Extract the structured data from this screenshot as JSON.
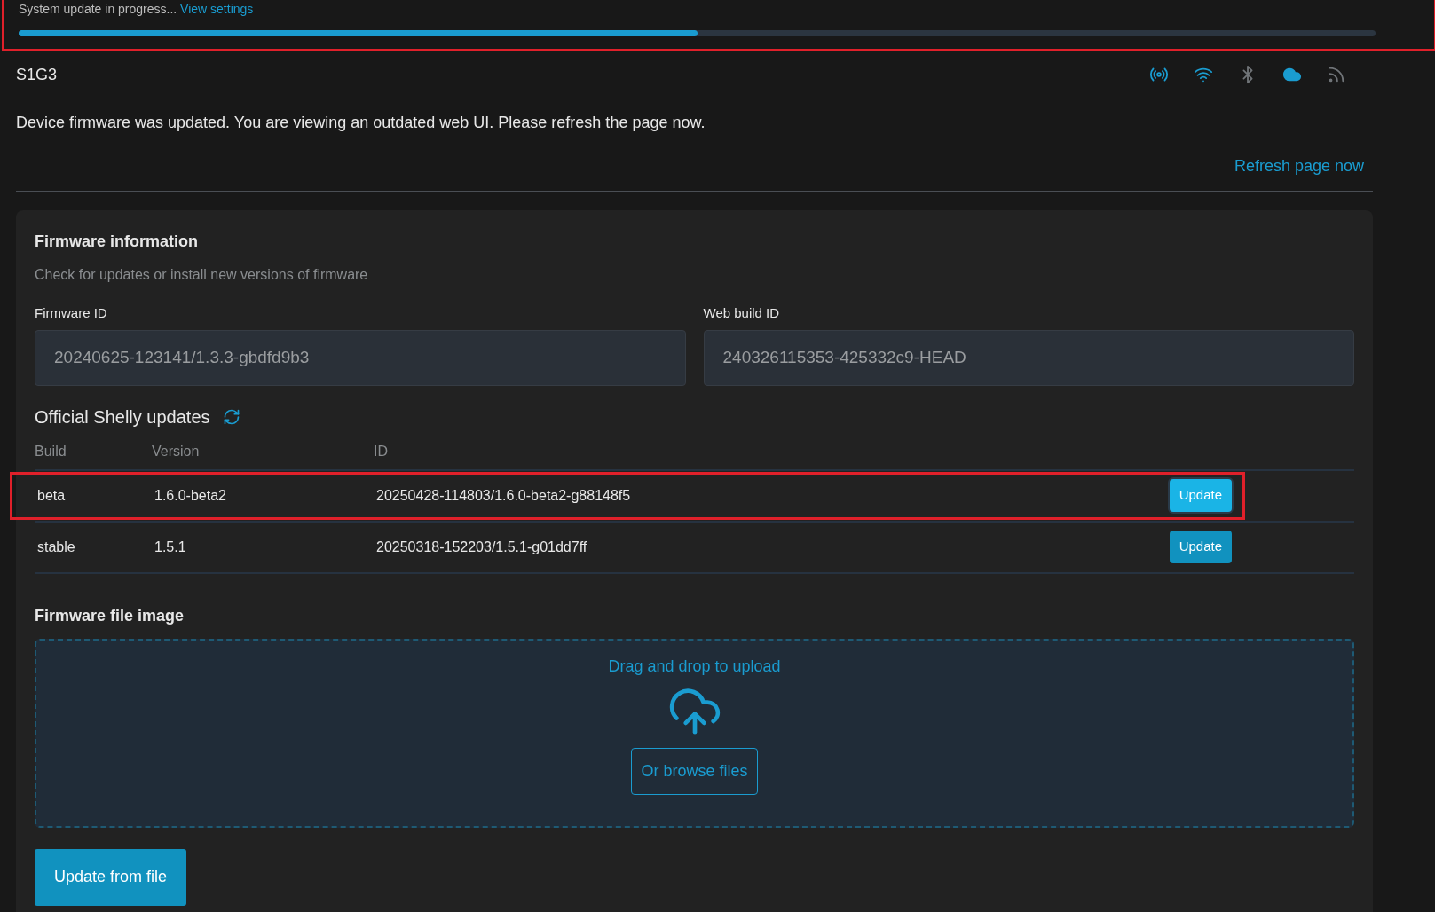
{
  "update_status": {
    "text": "System update in progress...",
    "link": "View settings",
    "level": 0.5,
    "highlighted": true
  },
  "device": {
    "name": "S1G3",
    "status_icons": [
      {
        "kind": "radio",
        "on": true
      },
      {
        "kind": "wifi",
        "on": true
      },
      {
        "kind": "bluetooth",
        "on": false
      },
      {
        "kind": "cloud",
        "on": true
      },
      {
        "kind": "rss",
        "on": false
      }
    ]
  },
  "notice": {
    "message": "Device firmware was updated. You are viewing an outdated web UI. Please refresh the page now.",
    "link": "Refresh page now"
  },
  "firmware_card": {
    "title": "Firmware information",
    "subtitle": "Check for updates or install new versions of firmware",
    "fields": [
      {
        "label": "Firmware ID",
        "value": "20240625-123141/1.3.3-gbdfd9b3"
      },
      {
        "label": "Web build ID",
        "value": "240326115353-425332c9-HEAD"
      }
    ],
    "updates_title": "Official Shelly updates",
    "table": {
      "columns": [
        "Build",
        "Version",
        "ID"
      ],
      "rows": [
        {
          "build": "beta",
          "version": "1.6.0-beta2",
          "id": "20250428-114803/1.6.0-beta2-g88148f5",
          "button": "Update",
          "highlighted": true
        },
        {
          "build": "stable",
          "version": "1.5.1",
          "id": "20250318-152203/1.5.1-g01dd7ff",
          "button": "Update",
          "highlighted": false
        }
      ]
    },
    "file_title": "Firmware file image",
    "dropzone": {
      "text": "Drag and drop to upload",
      "browse": "Or browse files"
    },
    "submit": "Update from file"
  }
}
